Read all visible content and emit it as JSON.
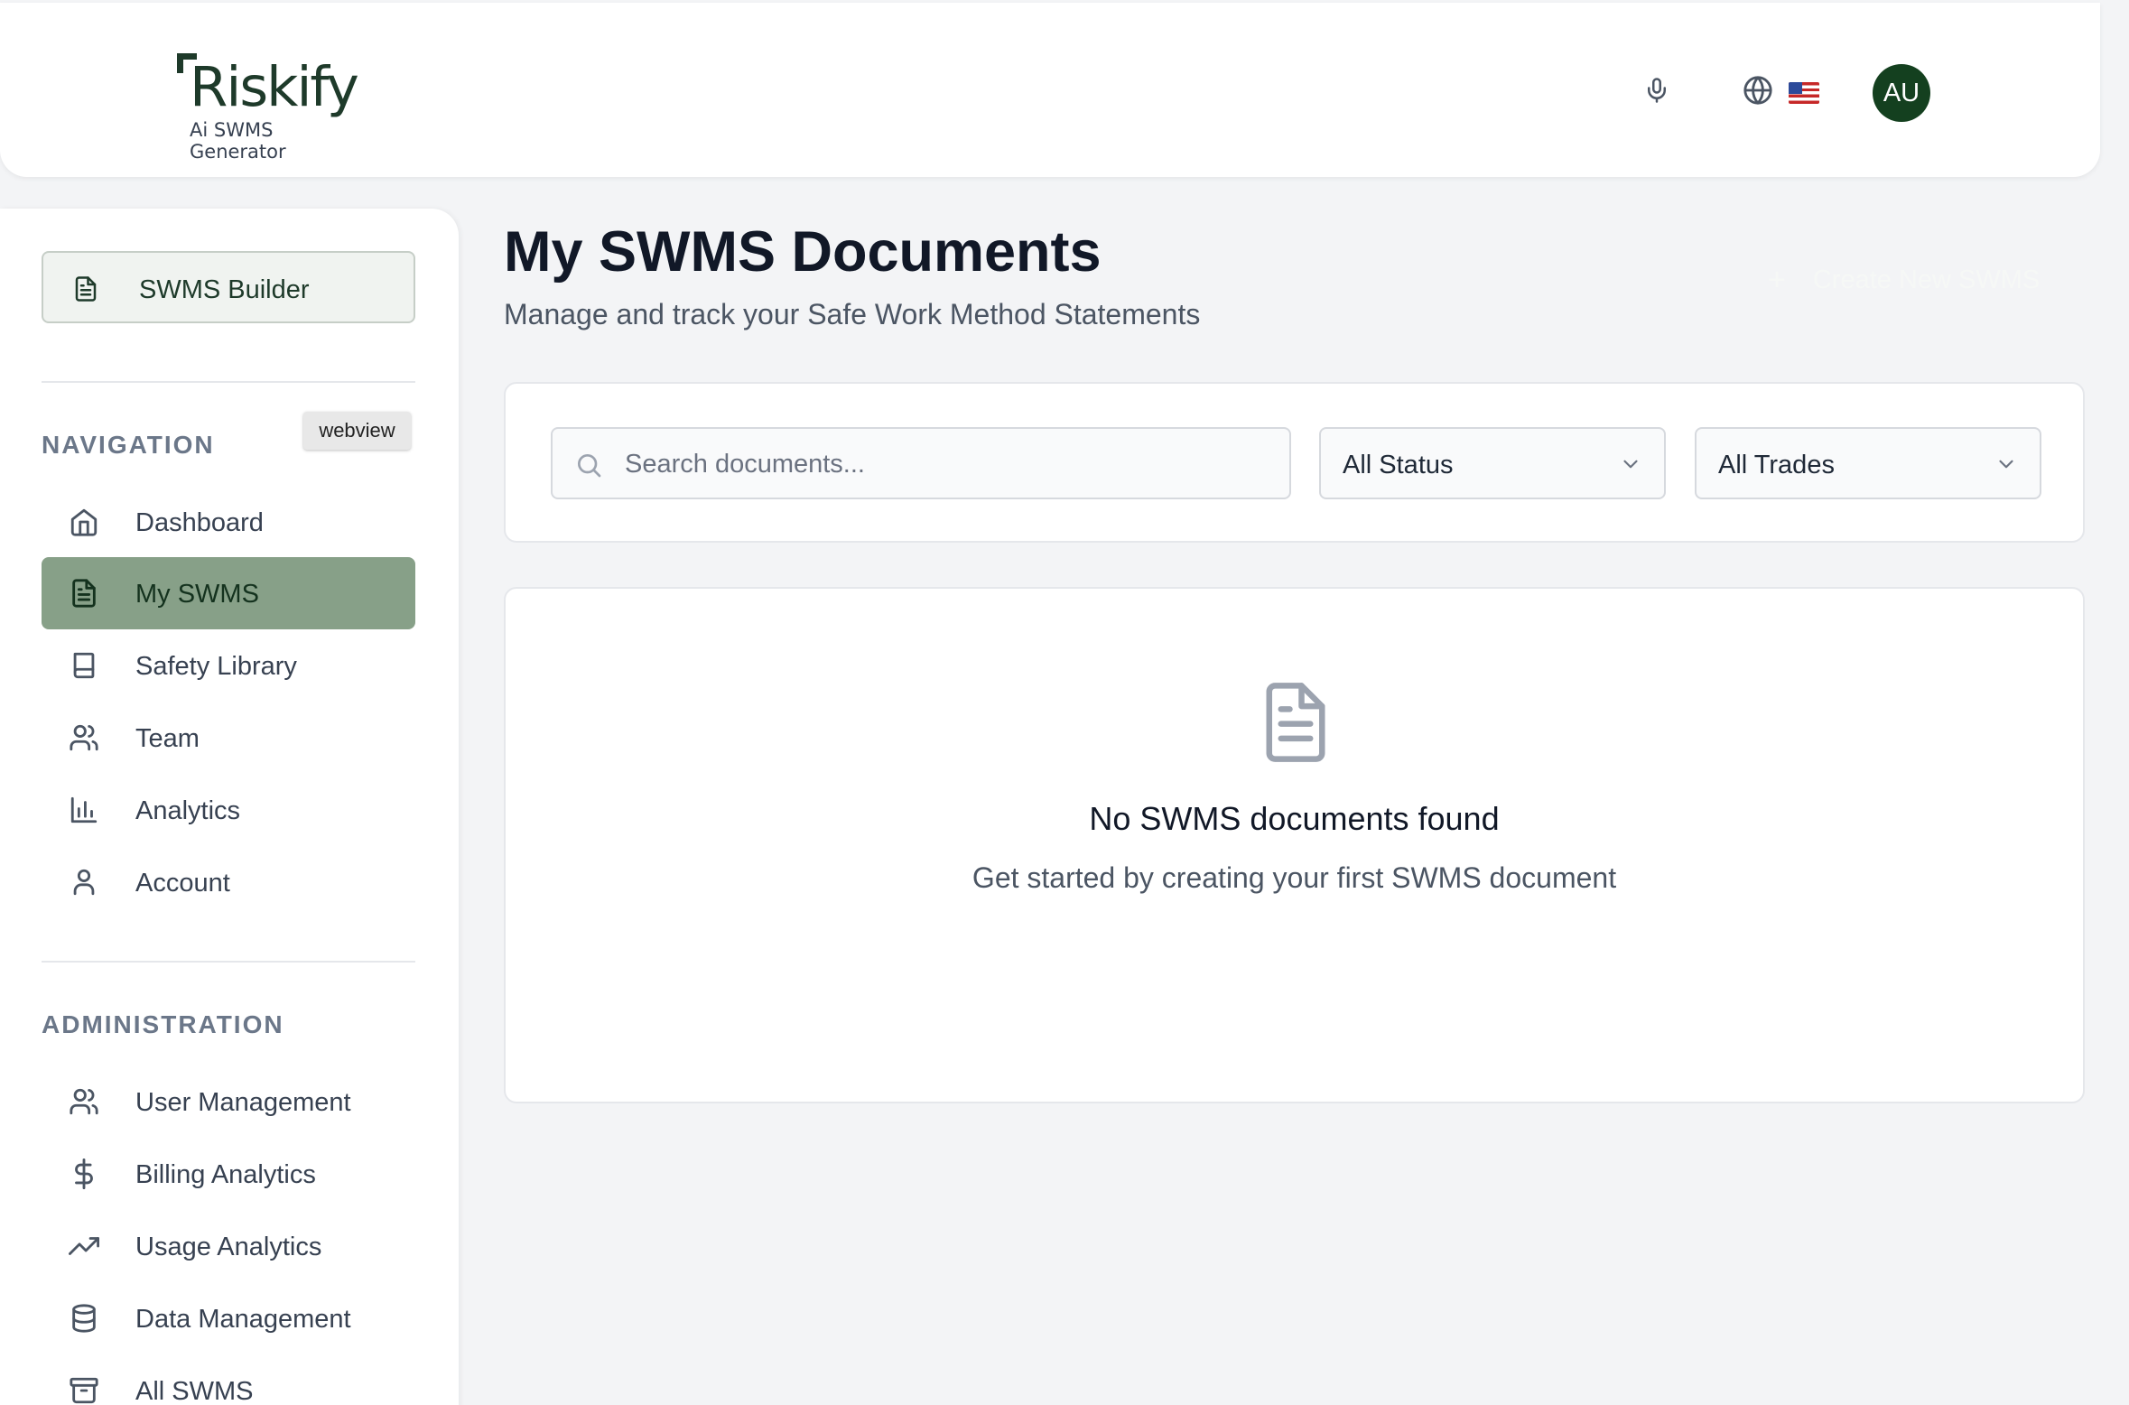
{
  "header": {
    "logo_text": "Riskify",
    "logo_subtitle": "Ai SWMS Generator",
    "icons": [
      "microphone-icon",
      "globe-icon",
      "us-flag-icon"
    ],
    "avatar_initials": "AU"
  },
  "sidebar": {
    "builder_label": "SWMS Builder",
    "webview_tag": "webview",
    "navigation_title": "NAVIGATION",
    "navigation_items": [
      {
        "label": "Dashboard",
        "icon": "home-icon"
      },
      {
        "label": "My SWMS",
        "icon": "document-icon",
        "active": true
      },
      {
        "label": "Safety Library",
        "icon": "book-icon"
      },
      {
        "label": "Team",
        "icon": "users-icon"
      },
      {
        "label": "Analytics",
        "icon": "bar-chart-icon"
      },
      {
        "label": "Account",
        "icon": "user-icon"
      }
    ],
    "administration_title": "ADMINISTRATION",
    "administration_items": [
      {
        "label": "User Management",
        "icon": "users-icon"
      },
      {
        "label": "Billing Analytics",
        "icon": "dollar-icon"
      },
      {
        "label": "Usage Analytics",
        "icon": "trending-up-icon"
      },
      {
        "label": "Data Management",
        "icon": "database-icon"
      },
      {
        "label": "All SWMS",
        "icon": "archive-icon"
      }
    ]
  },
  "main": {
    "title": "My SWMS Documents",
    "subtitle": "Manage and track your Safe Work Method Statements",
    "create_button": "Create New SWMS",
    "search_placeholder": "Search documents...",
    "status_filter": "All Status",
    "trade_filter": "All Trades",
    "empty_title": "No SWMS documents found",
    "empty_description": "Get started by creating your first SWMS document"
  },
  "colors": {
    "brand_dark": "#1e3a2a",
    "avatar_bg": "#14401f",
    "active_nav": "#87a088"
  }
}
